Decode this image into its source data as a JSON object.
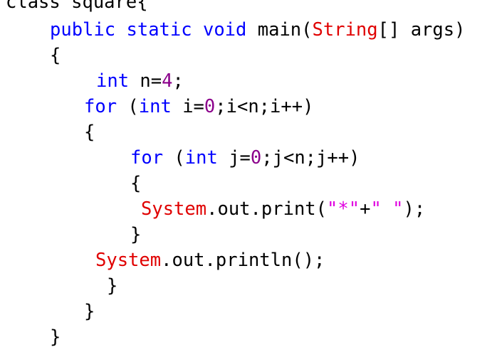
{
  "editor": {
    "colors": {
      "keyword": "#0000ff",
      "class_name": "#e00000",
      "number": "#8b008b",
      "string": "#e000e0",
      "plain": "#000000",
      "background": "#ffffff"
    },
    "lines": [
      [
        {
          "t": "class square{",
          "k": "txt"
        }
      ],
      [
        {
          "t": "public",
          "k": "kw"
        },
        {
          "t": " ",
          "k": "txt"
        },
        {
          "t": "static",
          "k": "kw"
        },
        {
          "t": " ",
          "k": "txt"
        },
        {
          "t": "void",
          "k": "kw"
        },
        {
          "t": " main(",
          "k": "txt"
        },
        {
          "t": "String",
          "k": "cls"
        },
        {
          "t": "[] args)",
          "k": "txt"
        }
      ],
      [
        {
          "t": "{",
          "k": "txt"
        }
      ],
      [
        {
          "t": "int",
          "k": "kw"
        },
        {
          "t": " n=",
          "k": "txt"
        },
        {
          "t": "4",
          "k": "num"
        },
        {
          "t": ";",
          "k": "txt"
        }
      ],
      [
        {
          "t": "for",
          "k": "kw"
        },
        {
          "t": " (",
          "k": "txt"
        },
        {
          "t": "int",
          "k": "kw"
        },
        {
          "t": " i=",
          "k": "txt"
        },
        {
          "t": "0",
          "k": "num"
        },
        {
          "t": ";i<n;i++)",
          "k": "txt"
        }
      ],
      [
        {
          "t": "{",
          "k": "txt"
        }
      ],
      [
        {
          "t": "for",
          "k": "kw"
        },
        {
          "t": " (",
          "k": "txt"
        },
        {
          "t": "int",
          "k": "kw"
        },
        {
          "t": " j=",
          "k": "txt"
        },
        {
          "t": "0",
          "k": "num"
        },
        {
          "t": ";j<n;j++)",
          "k": "txt"
        }
      ],
      [
        {
          "t": "{",
          "k": "txt"
        }
      ],
      [
        {
          "t": "System",
          "k": "cls"
        },
        {
          "t": ".out.print(",
          "k": "txt"
        },
        {
          "t": "\"*\"",
          "k": "str"
        },
        {
          "t": "+",
          "k": "txt"
        },
        {
          "t": "\" \"",
          "k": "str"
        },
        {
          "t": ");",
          "k": "txt"
        }
      ],
      [
        {
          "t": "}",
          "k": "txt"
        }
      ],
      [
        {
          "t": "System",
          "k": "cls"
        },
        {
          "t": ".out.println();",
          "k": "txt"
        }
      ],
      [
        {
          "t": "}",
          "k": "txt"
        }
      ],
      [
        {
          "t": "}",
          "k": "txt"
        }
      ],
      [
        {
          "t": "}",
          "k": "txt"
        }
      ]
    ]
  }
}
